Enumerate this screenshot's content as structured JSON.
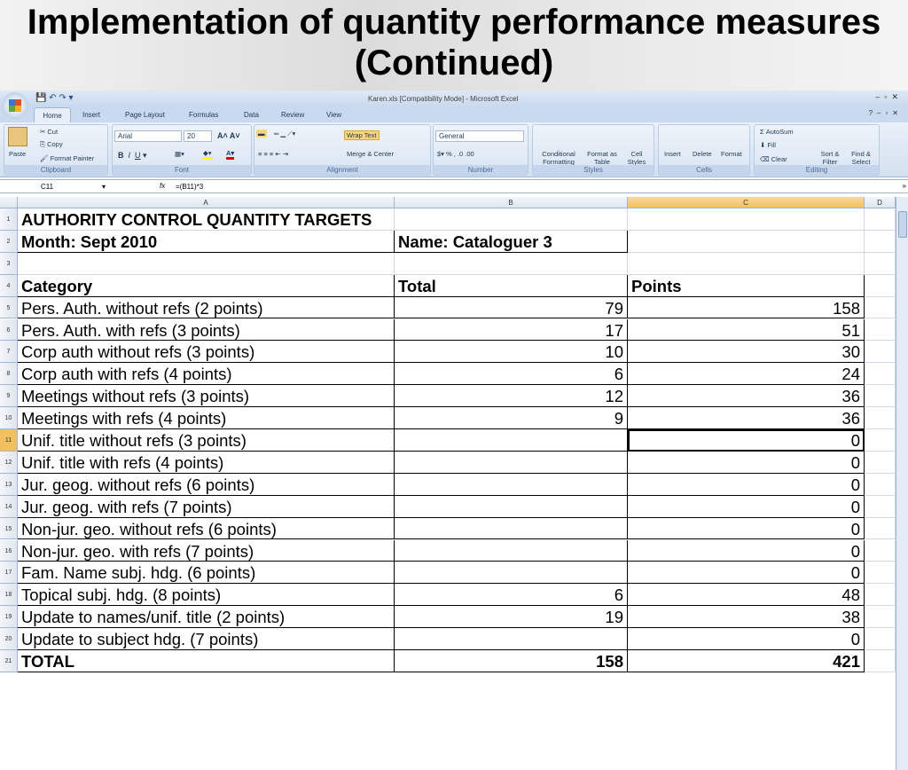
{
  "slide": {
    "title": "Implementation of quantity performance measures (Continued)"
  },
  "excel": {
    "window_title": "Karen.xls  [Compatibility Mode] - Microsoft Excel",
    "tabs": [
      "Home",
      "Insert",
      "Page Layout",
      "Formulas",
      "Data",
      "Review",
      "View"
    ],
    "ribbon": {
      "clipboard": {
        "paste": "Paste",
        "cut": "Cut",
        "copy": "Copy",
        "format_painter": "Format Painter",
        "label": "Clipboard"
      },
      "font": {
        "name": "Arial",
        "size": "20",
        "label": "Font"
      },
      "alignment": {
        "wrap": "Wrap Text",
        "merge": "Merge & Center",
        "label": "Alignment"
      },
      "number": {
        "format": "General",
        "label": "Number"
      },
      "styles": {
        "conditional": "Conditional Formatting",
        "format_table": "Format as Table",
        "cell_styles": "Cell Styles",
        "label": "Styles"
      },
      "cells": {
        "insert": "Insert",
        "delete": "Delete",
        "format": "Format",
        "label": "Cells"
      },
      "editing": {
        "autosum": "AutoSum",
        "fill": "Fill",
        "clear": "Clear",
        "sort": "Sort & Filter",
        "find": "Find & Select",
        "label": "Editing"
      }
    },
    "name_box": "C11",
    "formula": "=(B11)*3",
    "columns": [
      "A",
      "B",
      "C",
      "D"
    ],
    "rows": [
      [
        "AUTHORITY CONTROL QUANTITY TARGETS",
        "",
        ""
      ],
      [
        "Month: Sept 2010",
        "Name: Cataloguer 3",
        ""
      ],
      [
        "",
        "",
        ""
      ],
      [
        "Category",
        "Total",
        "Points"
      ],
      [
        "Pers. Auth. without refs (2 points)",
        "79",
        "158"
      ],
      [
        "Pers. Auth. with refs (3 points)",
        "17",
        "51"
      ],
      [
        "Corp auth without refs (3 points)",
        "10",
        "30"
      ],
      [
        "Corp auth with refs (4 points)",
        "6",
        "24"
      ],
      [
        "Meetings without refs (3 points)",
        "12",
        "36"
      ],
      [
        "Meetings with refs (4 points)",
        "9",
        "36"
      ],
      [
        "Unif. title without refs (3 points)",
        "",
        "0"
      ],
      [
        "Unif. title with refs (4 points)",
        "",
        "0"
      ],
      [
        "Jur. geog.  without refs (6 points)",
        "",
        "0"
      ],
      [
        "Jur. geog.  with refs (7 points)",
        "",
        "0"
      ],
      [
        "Non-jur. geo. without refs (6 points)",
        "",
        "0"
      ],
      [
        "Non-jur. geo. with refs (7 points)",
        "",
        "0"
      ],
      [
        "Fam. Name subj. hdg. (6 points)",
        "",
        "0"
      ],
      [
        "Topical subj. hdg. (8 points)",
        "6",
        "48"
      ],
      [
        "Update to names/unif. title (2 points)",
        "19",
        "38"
      ],
      [
        "Update to subject hdg. (7 points)",
        "",
        "0"
      ],
      [
        "TOTAL",
        "158",
        "421"
      ]
    ]
  }
}
